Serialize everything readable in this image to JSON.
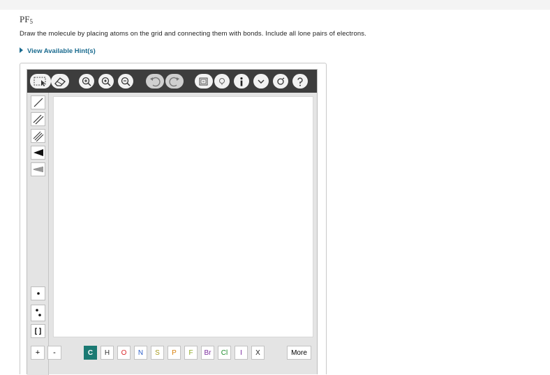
{
  "question": {
    "title_main": "PF",
    "title_sub": "5",
    "instructions": "Draw the molecule by placing atoms on the grid and connecting them with bonds. Include all lone pairs of electrons.",
    "hint_link": "View Available Hint(s)"
  },
  "toolbar": {
    "buttons": [
      "select-icon",
      "eraser-icon",
      "zoom-in-icon",
      "zoom-fit-icon",
      "zoom-out-icon",
      "undo-icon",
      "redo-icon",
      "template-icon",
      "clean-icon",
      "info-icon",
      "expand-icon",
      "settings-icon",
      "help-icon"
    ]
  },
  "left_tools": {
    "buttons": [
      "single-bond",
      "double-bond",
      "triple-bond",
      "wedge-bond",
      "hash-bond",
      "lone-electron",
      "lone-pair",
      "bracket"
    ],
    "bracket_label": "[ ]"
  },
  "bottom_bar": {
    "plus_label": "+",
    "minus_label": "-",
    "atoms": [
      {
        "symbol": "C",
        "color": "#ffffff",
        "bg": "#1b7a73"
      },
      {
        "symbol": "H",
        "color": "#333333",
        "bg": "#ffffff"
      },
      {
        "symbol": "O",
        "color": "#d9262a",
        "bg": "#ffffff"
      },
      {
        "symbol": "N",
        "color": "#2d5fc9",
        "bg": "#ffffff"
      },
      {
        "symbol": "S",
        "color": "#a89a1f",
        "bg": "#ffffff"
      },
      {
        "symbol": "P",
        "color": "#d9800c",
        "bg": "#ffffff"
      },
      {
        "symbol": "F",
        "color": "#8da824",
        "bg": "#ffffff"
      },
      {
        "symbol": "Br",
        "color": "#7b2c9e",
        "bg": "#ffffff"
      },
      {
        "symbol": "Cl",
        "color": "#1b8c2a",
        "bg": "#ffffff"
      },
      {
        "symbol": "I",
        "color": "#7b2c9e",
        "bg": "#ffffff"
      },
      {
        "symbol": "X",
        "color": "#222222",
        "bg": "#ffffff"
      }
    ],
    "more_label": "More"
  },
  "colors": {
    "toolbar_bg": "#3d3d3d",
    "panel_bg": "#e4e4e4",
    "hint_link": "#1a6b8f",
    "accent_teal": "#1b7a73"
  }
}
